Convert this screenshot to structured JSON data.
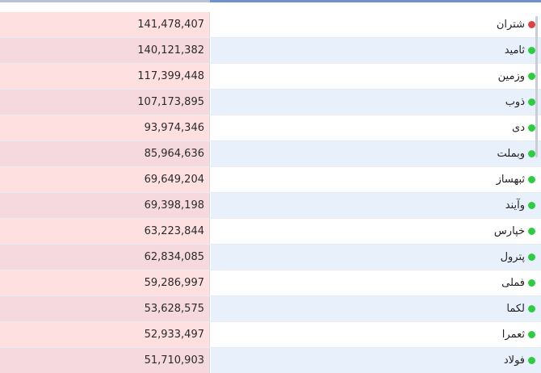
{
  "colors": {
    "active": "#2ecc40",
    "inactive": "#d94545"
  },
  "rows": [
    {
      "symbol": "شتران",
      "value": "141,478,407",
      "status": "inactive",
      "status_icon": "status-dot-icon"
    },
    {
      "symbol": "ثامید",
      "value": "140,121,382",
      "status": "active",
      "status_icon": "status-dot-icon"
    },
    {
      "symbol": "وزمین",
      "value": "117,399,448",
      "status": "active",
      "status_icon": "status-dot-icon"
    },
    {
      "symbol": "ذوب",
      "value": "107,173,895",
      "status": "active",
      "status_icon": "status-dot-icon"
    },
    {
      "symbol": "دی",
      "value": "93,974,346",
      "status": "active",
      "status_icon": "status-dot-icon"
    },
    {
      "symbol": "وبملت",
      "value": "85,964,636",
      "status": "active",
      "status_icon": "status-dot-icon"
    },
    {
      "symbol": "ثبهساز",
      "value": "69,649,204",
      "status": "active",
      "status_icon": "status-dot-icon"
    },
    {
      "symbol": "وآیند",
      "value": "69,398,198",
      "status": "active",
      "status_icon": "status-dot-icon"
    },
    {
      "symbol": "خپارس",
      "value": "63,223,844",
      "status": "active",
      "status_icon": "status-dot-icon"
    },
    {
      "symbol": "پترول",
      "value": "62,834,085",
      "status": "active",
      "status_icon": "status-dot-icon"
    },
    {
      "symbol": "فملی",
      "value": "59,286,997",
      "status": "active",
      "status_icon": "status-dot-icon"
    },
    {
      "symbol": "لکما",
      "value": "53,628,575",
      "status": "active",
      "status_icon": "status-dot-icon"
    },
    {
      "symbol": "ثعمرا",
      "value": "52,933,497",
      "status": "active",
      "status_icon": "status-dot-icon"
    },
    {
      "symbol": "فولاد",
      "value": "51,710,903",
      "status": "active",
      "status_icon": "status-dot-icon"
    }
  ]
}
